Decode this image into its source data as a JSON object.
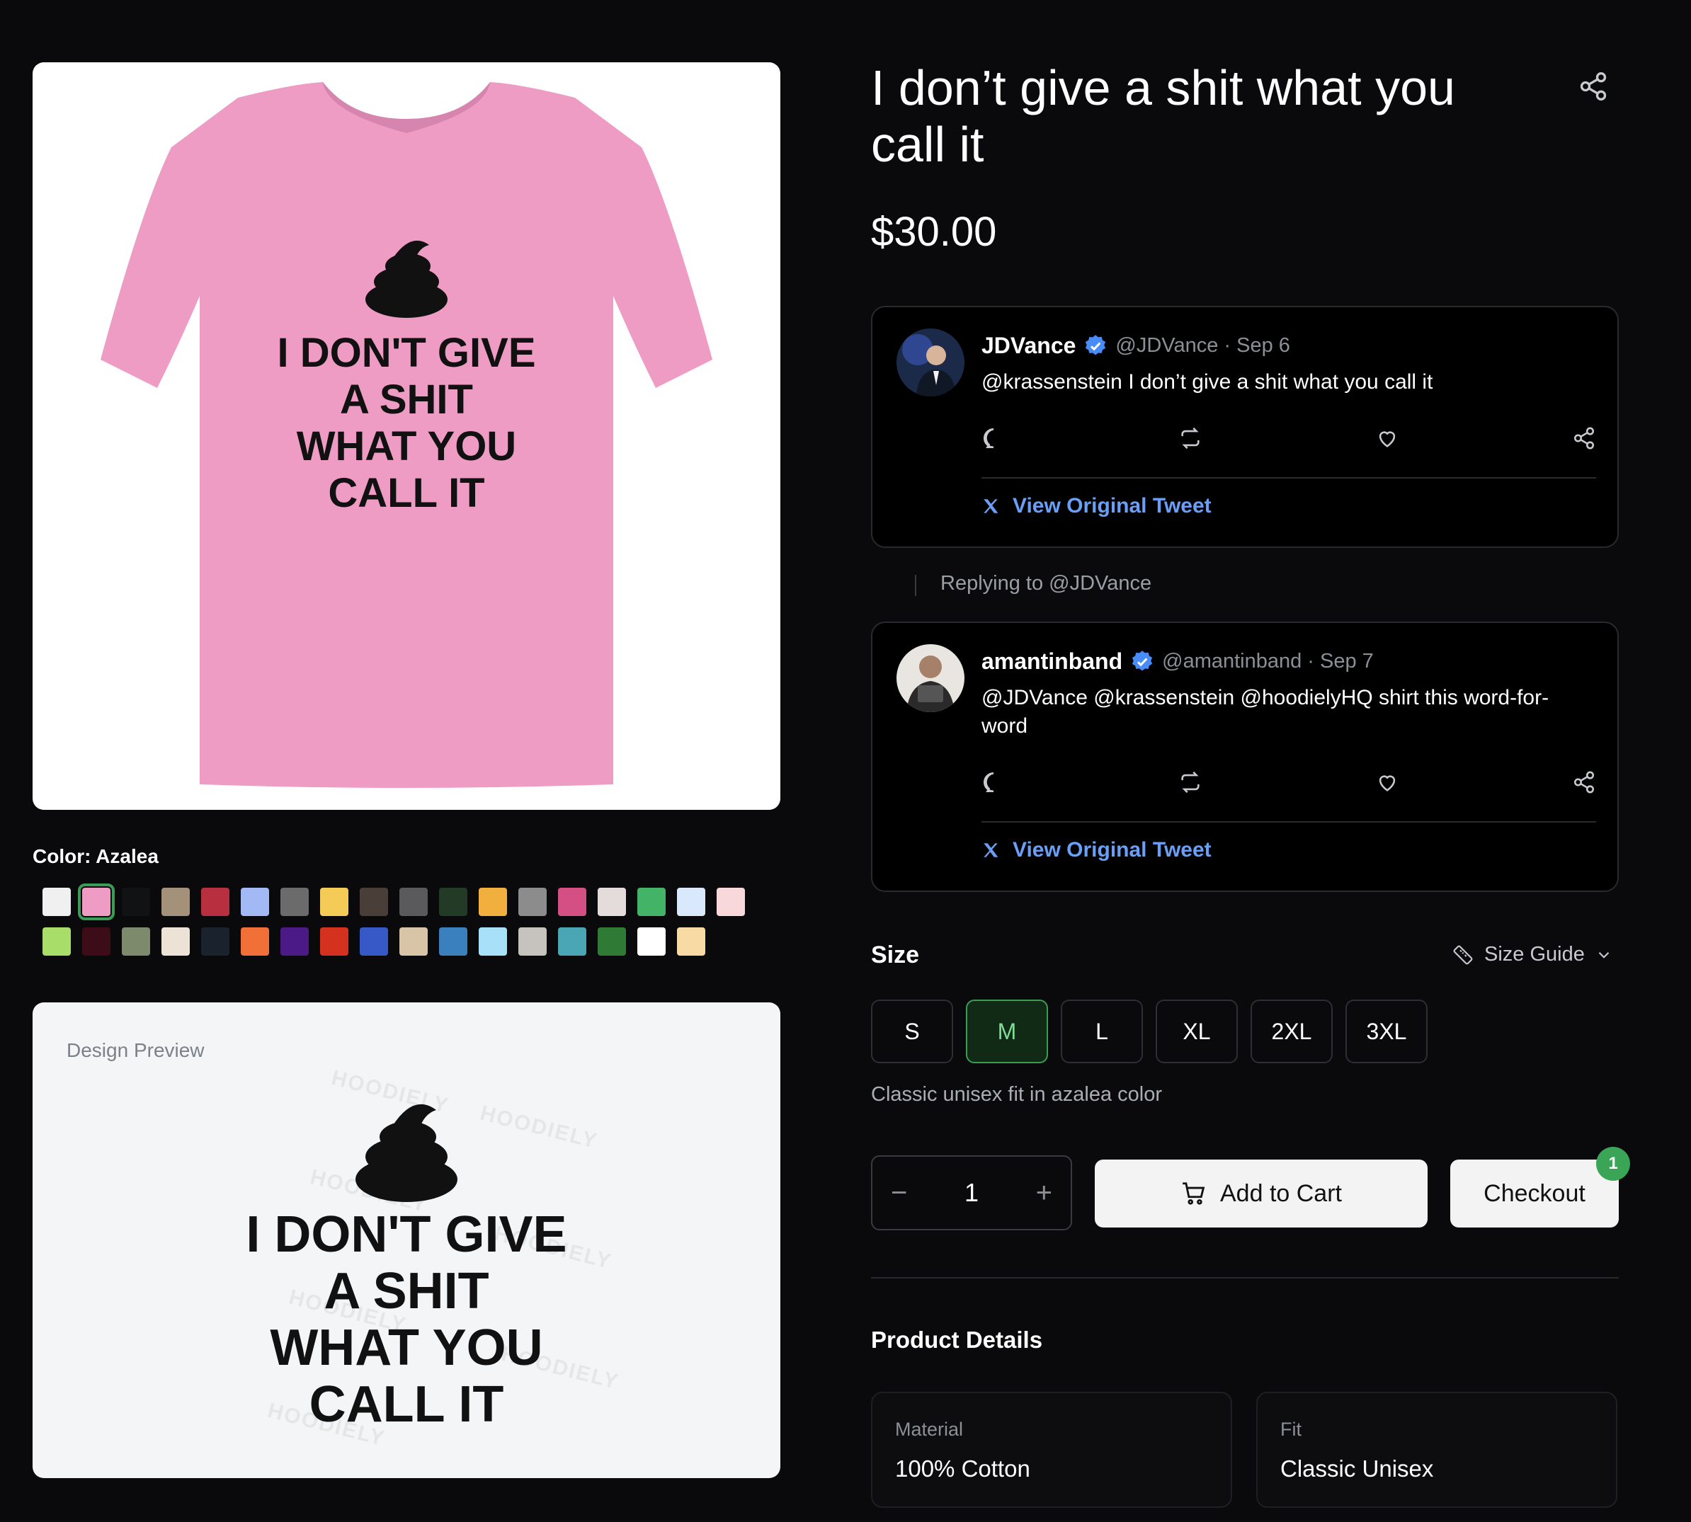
{
  "product": {
    "title": "I don’t give a shit what you call it",
    "price": "$30.00",
    "shirt_text": [
      "I DON'T GIVE",
      "A SHIT",
      "WHAT YOU",
      "CALL IT"
    ],
    "shirt_color": "#ee9cc4"
  },
  "color_picker": {
    "label": "Color: Azalea",
    "rows": [
      [
        "#f0f0f0",
        "#ee9cc4",
        "#111214",
        "#a39179",
        "#b8303f",
        "#a2b9f6",
        "#6b6b6b",
        "#f5cb58",
        "#4a3f38",
        "#5a5a5c",
        "#233a26",
        "#f1b03e",
        "#8c8c8c",
        "#d44f84",
        "#e4dcdb",
        "#43b368",
        "#d9e8fb",
        "#f8d8da"
      ],
      [
        "#a8dd6a",
        "#3c0d18",
        "#7e8a6c",
        "#ece3d6",
        "#1a222e",
        "#f07038",
        "#4c1a86",
        "#d4321f",
        "#3759c8",
        "#d8c5a8",
        "#3a80bf",
        "#a8e0fa",
        "#c6c2bd",
        "#4aa6b5",
        "#2f7a34",
        "#ffffff",
        "#f8daa4"
      ]
    ],
    "selected": "#ee9cc4"
  },
  "preview": {
    "label": "Design Preview",
    "watermark": "HOODIELY"
  },
  "tweets": [
    {
      "name": "JDVance",
      "handle": "@JDVance · Sep 6",
      "text": "@krassenstein I don’t give a shit what you call it",
      "link": "View Original Tweet"
    },
    {
      "name": "amantinband",
      "handle": "@amantinband · Sep 7",
      "text": "@JDVance @krassenstein @hoodielyHQ shirt this word-for-word",
      "link": "View Original Tweet"
    }
  ],
  "replying_to": "Replying to @JDVance",
  "size": {
    "label": "Size",
    "guide": "Size Guide",
    "options": [
      "S",
      "M",
      "L",
      "XL",
      "2XL",
      "3XL"
    ],
    "selected": "M",
    "fit_note": "Classic unisex fit in azalea color"
  },
  "cart": {
    "quantity": "1",
    "minus": "−",
    "plus": "+",
    "add_label": "Add to Cart",
    "checkout_label": "Checkout",
    "badge": "1"
  },
  "details": {
    "title": "Product Details",
    "items": [
      {
        "label": "Material",
        "value": "100% Cotton"
      },
      {
        "label": "Fit",
        "value": "Classic Unisex"
      }
    ]
  },
  "colors": {
    "accent_green": "#3aa457",
    "link_blue": "#6a9ff7",
    "verified_blue": "#4a8cf7"
  }
}
